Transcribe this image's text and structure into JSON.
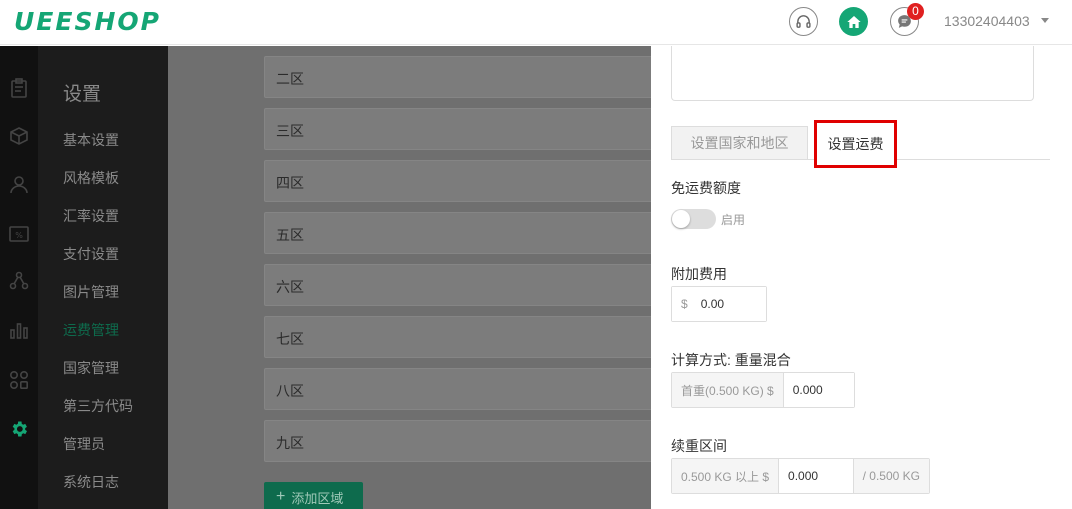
{
  "header": {
    "logo": "UEESHOP",
    "message_count": "0",
    "account": "13302404403"
  },
  "rail": {
    "icons": [
      "clipboard-icon",
      "cube-icon",
      "user-icon",
      "percent-icon",
      "share-icon",
      "bar-chart-icon",
      "apps-icon",
      "gear-icon"
    ]
  },
  "sidebar": {
    "title": "设置",
    "items": [
      {
        "label": "基本设置"
      },
      {
        "label": "风格模板"
      },
      {
        "label": "汇率设置"
      },
      {
        "label": "支付设置"
      },
      {
        "label": "图片管理"
      },
      {
        "label": "运费管理"
      },
      {
        "label": "国家管理"
      },
      {
        "label": "第三方代码"
      },
      {
        "label": "管理员"
      },
      {
        "label": "系统日志"
      }
    ],
    "active_index": 5
  },
  "zones": {
    "rows": [
      "二区",
      "三区",
      "四区",
      "五区",
      "六区",
      "七区",
      "八区",
      "九区"
    ],
    "add_label": "添加区域"
  },
  "panel": {
    "tabs": [
      {
        "label": "设置国家和地区"
      },
      {
        "label": "设置运费"
      }
    ],
    "free_shipping": {
      "label": "免运费额度",
      "toggle_text": "启用",
      "enabled": false
    },
    "extra_fee": {
      "label": "附加费用",
      "prefix": "$",
      "value": "0.00"
    },
    "calc": {
      "label": "计算方式: 重量混合",
      "prefix": "首重(0.500 KG) $",
      "value": "0.000"
    },
    "continued": {
      "label": "续重区间",
      "prefix": "0.500 KG 以上 $",
      "value": "0.000",
      "suffix": "/ 0.500 KG"
    }
  },
  "colors": {
    "brand": "#15a675",
    "highlight": "#e00000",
    "badge": "#e02020"
  }
}
